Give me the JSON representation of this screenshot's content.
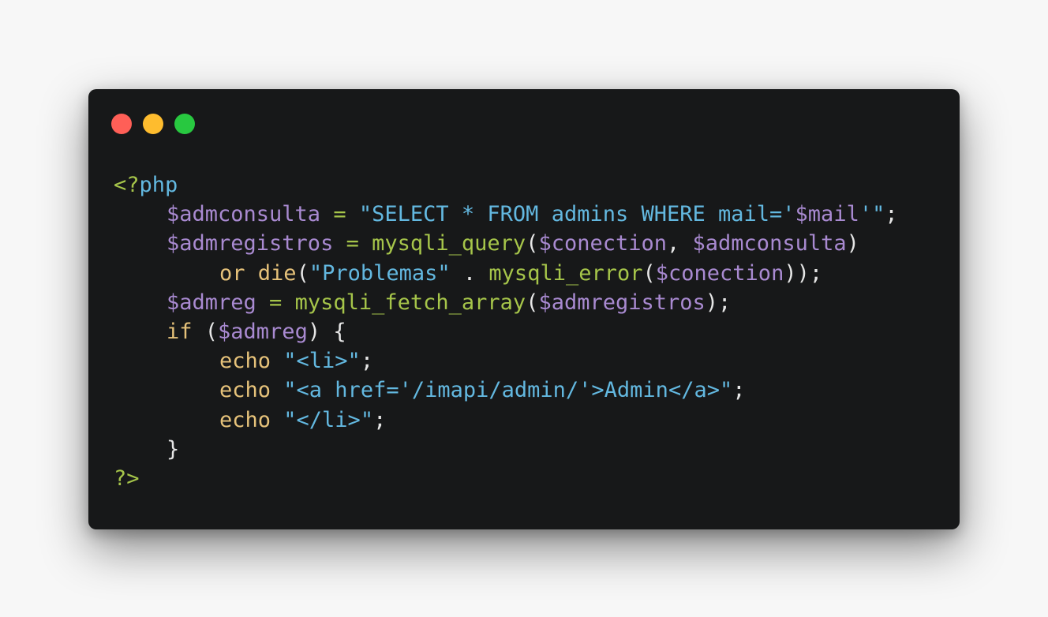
{
  "colors": {
    "background": "#171819",
    "page": "#f7f7f7",
    "red": "#ff5f57",
    "yellow": "#febc2e",
    "green": "#28c840",
    "variable": "#a98ad1",
    "function": "#a6c54a",
    "string": "#63b8e0",
    "keyword": "#e6c27a",
    "punct": "#e6e6e6"
  },
  "code": {
    "lines": [
      {
        "indent": 0,
        "tokens": [
          {
            "t": "<?",
            "c": "function"
          },
          {
            "t": "php",
            "c": "string"
          }
        ]
      },
      {
        "indent": 1,
        "tokens": [
          {
            "t": "$admconsulta",
            "c": "variable"
          },
          {
            "t": " = ",
            "c": "function"
          },
          {
            "t": "\"SELECT * FROM admins WHERE mail='",
            "c": "string"
          },
          {
            "t": "$mail",
            "c": "variable"
          },
          {
            "t": "'\"",
            "c": "string"
          },
          {
            "t": ";",
            "c": "punct"
          }
        ]
      },
      {
        "indent": 1,
        "tokens": [
          {
            "t": "$admregistros",
            "c": "variable"
          },
          {
            "t": " = ",
            "c": "function"
          },
          {
            "t": "mysqli_query",
            "c": "function"
          },
          {
            "t": "(",
            "c": "punct"
          },
          {
            "t": "$conection",
            "c": "variable"
          },
          {
            "t": ", ",
            "c": "punct"
          },
          {
            "t": "$admconsulta",
            "c": "variable"
          },
          {
            "t": ")",
            "c": "punct"
          }
        ]
      },
      {
        "indent": 2,
        "tokens": [
          {
            "t": "or ",
            "c": "keyword"
          },
          {
            "t": "die",
            "c": "keyword"
          },
          {
            "t": "(",
            "c": "punct"
          },
          {
            "t": "\"Problemas\"",
            "c": "string"
          },
          {
            "t": " . ",
            "c": "punct"
          },
          {
            "t": "mysqli_error",
            "c": "function"
          },
          {
            "t": "(",
            "c": "punct"
          },
          {
            "t": "$conection",
            "c": "variable"
          },
          {
            "t": "));",
            "c": "punct"
          }
        ]
      },
      {
        "indent": 1,
        "tokens": [
          {
            "t": "$admreg",
            "c": "variable"
          },
          {
            "t": " = ",
            "c": "function"
          },
          {
            "t": "mysqli_fetch_array",
            "c": "function"
          },
          {
            "t": "(",
            "c": "punct"
          },
          {
            "t": "$admregistros",
            "c": "variable"
          },
          {
            "t": ");",
            "c": "punct"
          }
        ]
      },
      {
        "indent": 1,
        "tokens": [
          {
            "t": "if",
            "c": "keyword"
          },
          {
            "t": " (",
            "c": "punct"
          },
          {
            "t": "$admreg",
            "c": "variable"
          },
          {
            "t": ") {",
            "c": "punct"
          }
        ]
      },
      {
        "indent": 2,
        "tokens": [
          {
            "t": "echo ",
            "c": "keyword"
          },
          {
            "t": "\"<li>\"",
            "c": "string"
          },
          {
            "t": ";",
            "c": "punct"
          }
        ]
      },
      {
        "indent": 2,
        "tokens": [
          {
            "t": "echo ",
            "c": "keyword"
          },
          {
            "t": "\"<a href='/imapi/admin/'>Admin</a>\"",
            "c": "string"
          },
          {
            "t": ";",
            "c": "punct"
          }
        ]
      },
      {
        "indent": 2,
        "tokens": [
          {
            "t": "echo ",
            "c": "keyword"
          },
          {
            "t": "\"</li>\"",
            "c": "string"
          },
          {
            "t": ";",
            "c": "punct"
          }
        ]
      },
      {
        "indent": 1,
        "tokens": [
          {
            "t": "}",
            "c": "punct"
          }
        ]
      },
      {
        "indent": 0,
        "tokens": [
          {
            "t": "?>",
            "c": "function"
          }
        ]
      }
    ]
  }
}
